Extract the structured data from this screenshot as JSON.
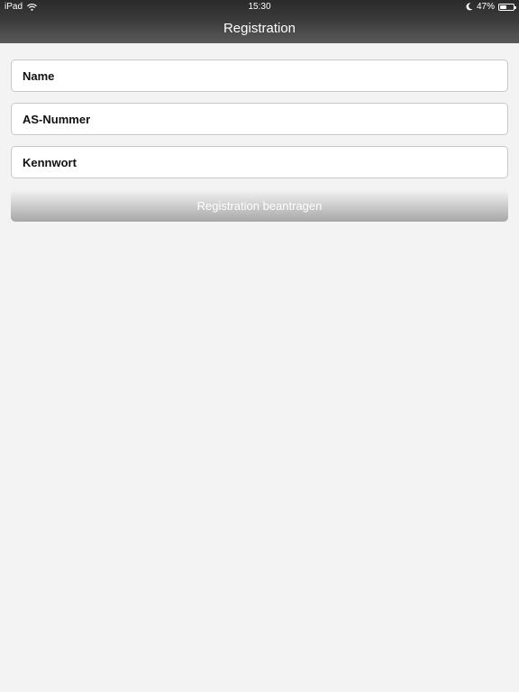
{
  "status_bar": {
    "device": "iPad",
    "time": "15:30",
    "battery_text": "47%",
    "battery_level": 0.47,
    "icons": [
      "wifi-icon",
      "moon-icon",
      "battery-icon"
    ]
  },
  "nav": {
    "title": "Registration"
  },
  "form": {
    "name_placeholder": "Name",
    "name_value": "",
    "as_number_placeholder": "AS-Nummer",
    "as_number_value": "",
    "password_placeholder": "Kennwort",
    "password_value": "",
    "submit_label": "Registration beantragen"
  },
  "colors": {
    "background": "#f3f3f3",
    "header_dark": "#2a2a2a",
    "header_light": "#5a5a5a",
    "button_gradient_top": "#f2f2f2",
    "button_gradient_bottom": "#a7a7a7",
    "field_border": "#c8c8c8"
  }
}
